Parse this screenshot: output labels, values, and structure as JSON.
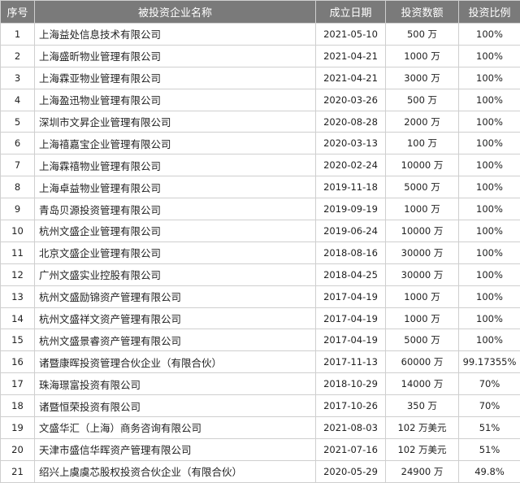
{
  "headers": [
    "序号",
    "被投资企业名称",
    "成立日期",
    "投资数额",
    "投资比例"
  ],
  "rows": [
    {
      "no": "1",
      "name": "上海益处信息技术有限公司",
      "date": "2021-05-10",
      "amount": "500 万",
      "ratio": "100%"
    },
    {
      "no": "2",
      "name": "上海盛昕物业管理有限公司",
      "date": "2021-04-21",
      "amount": "1000 万",
      "ratio": "100%"
    },
    {
      "no": "3",
      "name": "上海霖亚物业管理有限公司",
      "date": "2021-04-21",
      "amount": "3000 万",
      "ratio": "100%"
    },
    {
      "no": "4",
      "name": "上海盈迅物业管理有限公司",
      "date": "2020-03-26",
      "amount": "500 万",
      "ratio": "100%"
    },
    {
      "no": "5",
      "name": "深圳市文昇企业管理有限公司",
      "date": "2020-08-28",
      "amount": "2000 万",
      "ratio": "100%"
    },
    {
      "no": "6",
      "name": "上海禧嘉宝企业管理有限公司",
      "date": "2020-03-13",
      "amount": "100 万",
      "ratio": "100%"
    },
    {
      "no": "7",
      "name": "上海霖禧物业管理有限公司",
      "date": "2020-02-24",
      "amount": "10000 万",
      "ratio": "100%"
    },
    {
      "no": "8",
      "name": "上海卓益物业管理有限公司",
      "date": "2019-11-18",
      "amount": "5000 万",
      "ratio": "100%"
    },
    {
      "no": "9",
      "name": "青岛贝源投资管理有限公司",
      "date": "2019-09-19",
      "amount": "1000 万",
      "ratio": "100%"
    },
    {
      "no": "10",
      "name": "杭州文盛企业管理有限公司",
      "date": "2019-06-24",
      "amount": "10000 万",
      "ratio": "100%"
    },
    {
      "no": "11",
      "name": "北京文盛企业管理有限公司",
      "date": "2018-08-16",
      "amount": "30000 万",
      "ratio": "100%"
    },
    {
      "no": "12",
      "name": "广州文盛实业控股有限公司",
      "date": "2018-04-25",
      "amount": "30000 万",
      "ratio": "100%"
    },
    {
      "no": "13",
      "name": "杭州文盛励锦资产管理有限公司",
      "date": "2017-04-19",
      "amount": "1000 万",
      "ratio": "100%"
    },
    {
      "no": "14",
      "name": "杭州文盛祥文资产管理有限公司",
      "date": "2017-04-19",
      "amount": "1000 万",
      "ratio": "100%"
    },
    {
      "no": "15",
      "name": "杭州文盛景睿资产管理有限公司",
      "date": "2017-04-19",
      "amount": "5000 万",
      "ratio": "100%"
    },
    {
      "no": "16",
      "name": "诸暨康晖投资管理合伙企业（有限合伙）",
      "date": "2017-11-13",
      "amount": "60000 万",
      "ratio": "99.17355%"
    },
    {
      "no": "17",
      "name": "珠海璟富投资有限公司",
      "date": "2018-10-29",
      "amount": "14000 万",
      "ratio": "70%"
    },
    {
      "no": "18",
      "name": "诸暨恒荣投资有限公司",
      "date": "2017-10-26",
      "amount": "350 万",
      "ratio": "70%"
    },
    {
      "no": "19",
      "name": "文盛华汇（上海）商务咨询有限公司",
      "date": "2021-08-03",
      "amount": "102 万美元",
      "ratio": "51%"
    },
    {
      "no": "20",
      "name": "天津市盛信华晖资产管理有限公司",
      "date": "2021-07-16",
      "amount": "102 万美元",
      "ratio": "51%"
    },
    {
      "no": "21",
      "name": "绍兴上虞虞芯股权投资合伙企业（有限合伙）",
      "date": "2020-05-29",
      "amount": "24900 万",
      "ratio": "49.8%"
    }
  ]
}
